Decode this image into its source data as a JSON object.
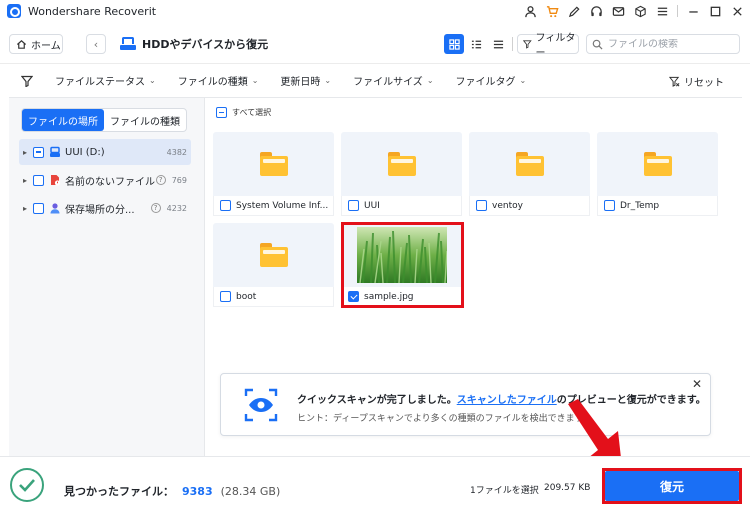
{
  "app": {
    "title": "Wondershare Recoverit"
  },
  "titlebar": {
    "icons": [
      "user-icon",
      "cart-icon",
      "pen-icon",
      "headset-icon",
      "mail-icon",
      "box-icon",
      "menu-icon",
      "minimize-icon",
      "maximize-icon",
      "close-icon"
    ]
  },
  "toolbar": {
    "home_label": "ホーム",
    "breadcrumb": "HDDやデバイスから復元",
    "filter_label": "フィルター",
    "search_placeholder": "ファイルの検索"
  },
  "filters": {
    "items": [
      "ファイルステータス",
      "ファイルの種類",
      "更新日時",
      "ファイルサイズ",
      "ファイルタグ"
    ],
    "reset_label": "リセット"
  },
  "sidebar": {
    "tabs": [
      "ファイルの場所",
      "ファイルの種類"
    ],
    "tree": [
      {
        "label": "UUI (D:)",
        "count": "4382"
      },
      {
        "label": "名前のないファイル",
        "count": "769"
      },
      {
        "label": "保存場所の分...",
        "count": "4232"
      }
    ]
  },
  "main": {
    "select_all_label": "すべて選択",
    "items": [
      {
        "name": "System Volume Inf...",
        "type": "folder"
      },
      {
        "name": "UUI",
        "type": "folder"
      },
      {
        "name": "ventoy",
        "type": "folder"
      },
      {
        "name": "Dr_Temp",
        "type": "folder"
      },
      {
        "name": "boot",
        "type": "folder"
      },
      {
        "name": "sample.jpg",
        "type": "image",
        "checked": true
      }
    ]
  },
  "toast": {
    "title_prefix": "クイックスキャンが完了しました。",
    "title_link": "スキャンしたファイル",
    "title_suffix": "のプレビューと復元ができます。",
    "hint": "ヒント：ディープスキャンでより多くの種類のファイルを検出できます。"
  },
  "status": {
    "found_label": "見つかったファイル：",
    "found_count": "9383",
    "found_size": "(28.34 GB)",
    "selected_label": "1ファイルを選択",
    "selected_size": "209.57 KB",
    "recover_label": "復元"
  },
  "colors": {
    "accent": "#1a6ff5",
    "highlight": "#e3101a",
    "folder": "#ffc233",
    "success": "#3aa37c"
  }
}
